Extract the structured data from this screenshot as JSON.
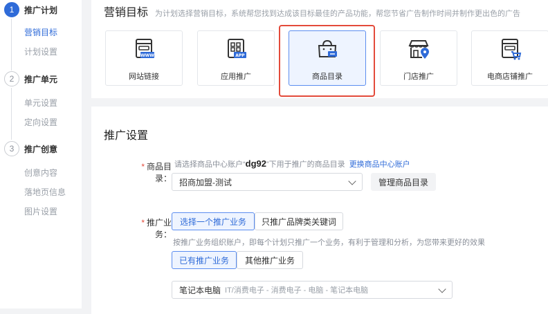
{
  "sidebar": {
    "steps": [
      {
        "num": "1",
        "label": "推广计划",
        "subs": [
          "营销目标",
          "计划设置"
        ]
      },
      {
        "num": "2",
        "label": "推广单元",
        "subs": [
          "单元设置",
          "定向设置"
        ]
      },
      {
        "num": "3",
        "label": "推广创意",
        "subs": [
          "创意内容",
          "落地页信息",
          "图片设置"
        ]
      }
    ]
  },
  "marketing": {
    "title": "营销目标",
    "desc": "为计划选择营销目标，系统帮您找到达成该目标最佳的产品功能，帮您节省广告制作时间并制作更出色的广告",
    "cards": [
      {
        "label": "网站链接",
        "icon": "website-link-icon"
      },
      {
        "label": "应用推广",
        "icon": "app-promotion-icon"
      },
      {
        "label": "商品目录",
        "icon": "product-catalog-icon"
      },
      {
        "label": "门店推广",
        "icon": "store-promotion-icon"
      },
      {
        "label": "电商店铺推广",
        "icon": "ecommerce-store-icon"
      }
    ],
    "selected_index": 2
  },
  "promo": {
    "title": "推广设置",
    "catalog": {
      "label": "商品目录：",
      "hint_prefix": "请选择商品中心账户“",
      "account": "dg92",
      "hint_suffix": "”下用于推广的商品目录",
      "switch_link": "更换商品中心账户",
      "selected": "招商加盟-测试",
      "manage_button": "管理商品目录"
    },
    "business": {
      "label": "推广业务：",
      "options": [
        "选择一个推广业务",
        "只推广品牌类关键词"
      ],
      "hint": "按推广业务组织账户，即每个计划只推广一个业务，有利于管理和分析，为您带来更好的效果",
      "sub_options": [
        "已有推广业务",
        "其他推广业务"
      ],
      "selected_business": "笔记本电脑",
      "selected_path": "IT/消费电子 - 消费电子 - 电脑 - 笔记本电脑"
    }
  },
  "colors": {
    "accent": "#2f6bd8",
    "highlight": "#e34a3a"
  }
}
